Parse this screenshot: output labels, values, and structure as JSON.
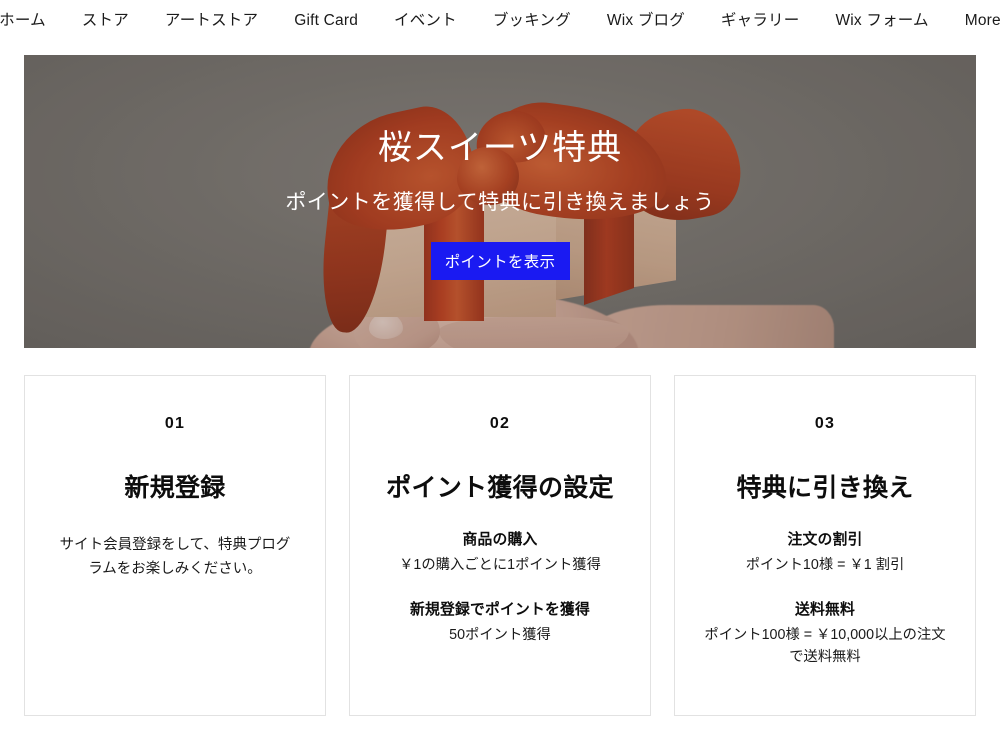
{
  "nav": {
    "items": [
      {
        "label": "ホーム"
      },
      {
        "label": "ストア"
      },
      {
        "label": "アートストア"
      },
      {
        "label": "Gift Card"
      },
      {
        "label": "イベント"
      },
      {
        "label": "ブッキング"
      },
      {
        "label": "Wix ブログ"
      },
      {
        "label": "ギャラリー"
      },
      {
        "label": "Wix フォーム"
      },
      {
        "label": "More"
      }
    ]
  },
  "hero": {
    "title": "桜スイーツ特典",
    "subtitle": "ポイントを獲得して特典に引き換えましょう",
    "cta_label": "ポイントを表示",
    "cta_color": "#1a1af2",
    "background_color": "#7d7974",
    "ribbon_color": "#bc3f1d",
    "box_color": "#e4c4aa",
    "image_description": "hand-holding-gift-box-with-red-ribbon"
  },
  "cards": [
    {
      "number": "01",
      "title": "新規登録",
      "body": "サイト会員登録をして、特典プログラムをお楽しみください。",
      "sections": []
    },
    {
      "number": "02",
      "title": "ポイント獲得の設定",
      "body": "",
      "sections": [
        {
          "head": "商品の購入",
          "text": "￥1の購入ごとに1ポイント獲得"
        },
        {
          "head": "新規登録でポイントを獲得",
          "text": "50ポイント獲得"
        }
      ]
    },
    {
      "number": "03",
      "title": "特典に引き換え",
      "body": "",
      "sections": [
        {
          "head": "注文の割引",
          "text": "ポイント10様 = ￥1 割引"
        },
        {
          "head": "送料無料",
          "text": "ポイント100様 = ￥10,000以上の注文で送料無料"
        }
      ]
    }
  ]
}
